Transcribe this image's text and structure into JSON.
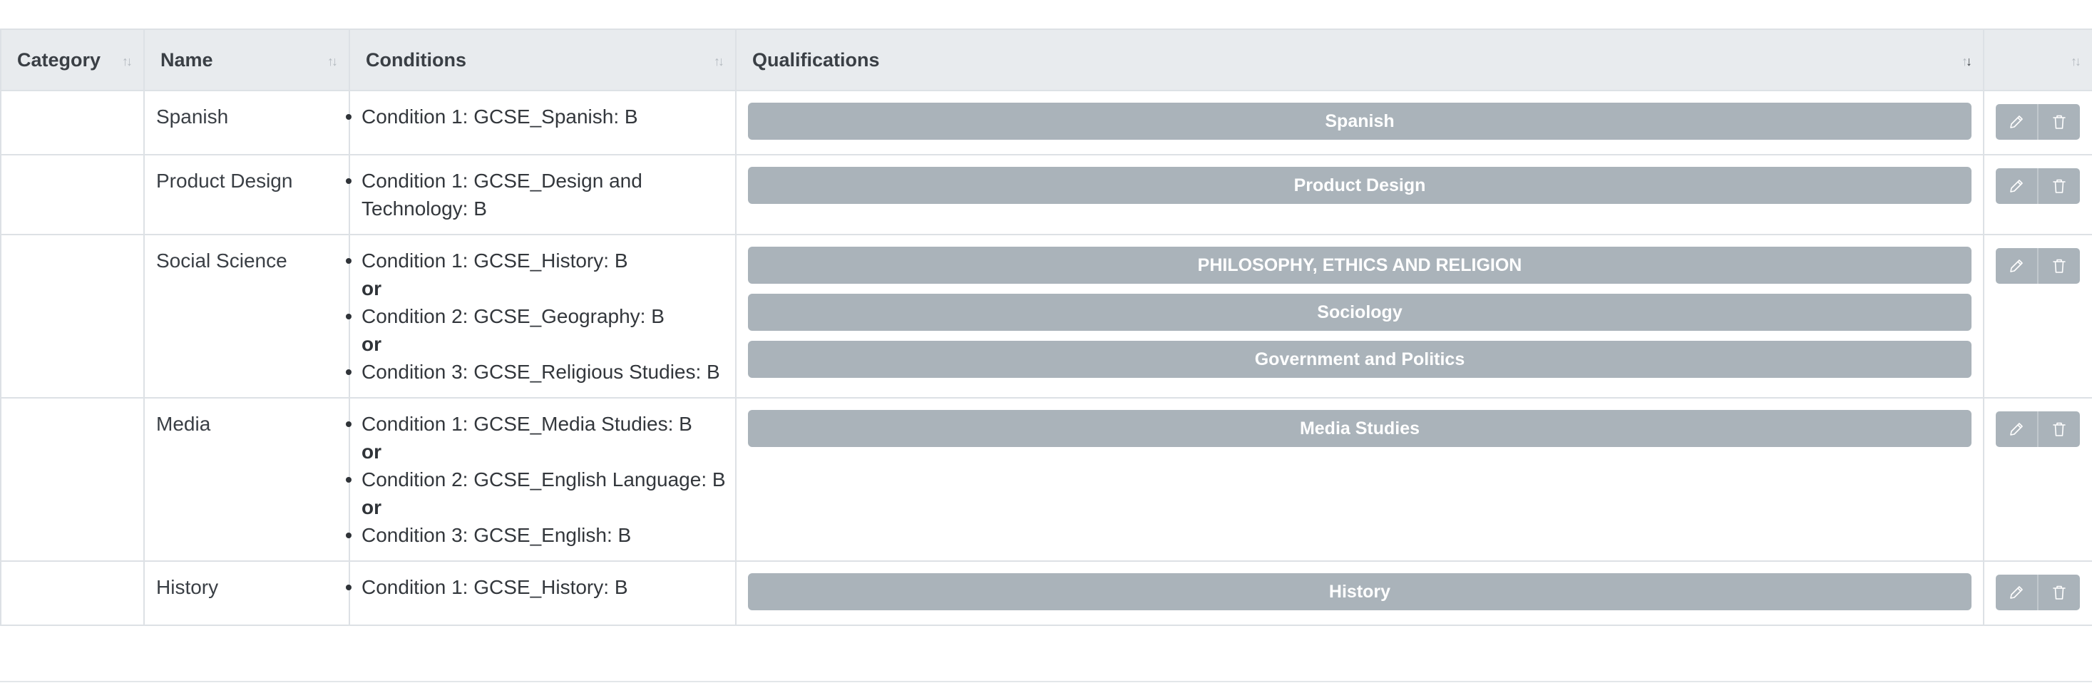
{
  "table": {
    "headers": {
      "category": "Category",
      "name": "Name",
      "conditions": "Conditions",
      "qualifications": "Qualifications",
      "actions": ""
    },
    "or_label": "or",
    "rows": [
      {
        "category": "",
        "name": "Spanish",
        "conditions": [
          "Condition 1: GCSE_Spanish: B"
        ],
        "qualifications": [
          "Spanish"
        ]
      },
      {
        "category": "",
        "name": "Product Design",
        "conditions": [
          "Condition 1: GCSE_Design and Technology: B"
        ],
        "qualifications": [
          "Product Design"
        ]
      },
      {
        "category": "",
        "name": "Social Science",
        "conditions": [
          "Condition 1: GCSE_History: B",
          "Condition 2: GCSE_Geography: B",
          "Condition 3: GCSE_Religious Studies: B"
        ],
        "qualifications": [
          "PHILOSOPHY, ETHICS AND RELIGION",
          "Sociology",
          "Government and Politics"
        ]
      },
      {
        "category": "",
        "name": "Media",
        "conditions": [
          "Condition 1: GCSE_Media Studies: B",
          "Condition 2: GCSE_English Language: B",
          "Condition 3: GCSE_English: B"
        ],
        "qualifications": [
          "Media Studies"
        ]
      },
      {
        "category": "",
        "name": "History",
        "conditions": [
          "Condition 1: GCSE_History: B"
        ],
        "qualifications": [
          "History"
        ]
      }
    ]
  },
  "icons": {
    "sort": "sort-arrows-icon",
    "edit": "pencil-icon",
    "delete": "trash-icon"
  },
  "colors": {
    "header_bg": "#e8ebee",
    "pill_bg": "#aab3ba",
    "border": "#dde1e5"
  }
}
